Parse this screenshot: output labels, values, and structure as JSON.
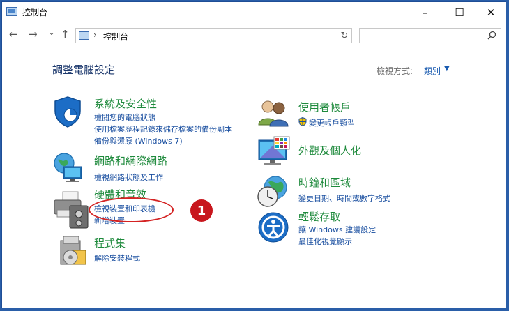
{
  "window": {
    "title": "控制台",
    "buttons": {
      "minimize": "–",
      "maximize": "☐",
      "close": "✕"
    }
  },
  "nav": {
    "back": "←",
    "forward": "→",
    "dropdown": "⌄",
    "up": "↑"
  },
  "address": {
    "separator": "›",
    "path": "控制台",
    "refresh": "↻"
  },
  "search": {
    "placeholder": "",
    "icon": "search-icon"
  },
  "heading": "調整電腦設定",
  "view": {
    "label": "檢視方式:",
    "value": "類別",
    "caret": "▼"
  },
  "categories_left": [
    {
      "title": "系統及安全性",
      "icon": "shield-icon",
      "links": [
        "檢閱您的電腦狀態",
        "使用檔案歷程記錄來儲存檔案的備份副本",
        "備份與還原 (Windows 7)"
      ]
    },
    {
      "title": "網路和網際網路",
      "icon": "network-globe-icon",
      "links": [
        "檢視網路狀態及工作"
      ]
    },
    {
      "title": "硬體和音效",
      "icon": "printer-icon",
      "links": [
        "檢視裝置和印表機",
        "新增裝置"
      ]
    },
    {
      "title": "程式集",
      "icon": "programs-icon",
      "links": [
        "解除安裝程式"
      ]
    }
  ],
  "categories_right": [
    {
      "title": "使用者帳戶",
      "icon": "users-icon",
      "links": [
        "變更帳戶類型"
      ]
    },
    {
      "title": "外觀及個人化",
      "icon": "monitor-icon",
      "links": []
    },
    {
      "title": "時鐘和區域",
      "icon": "clock-globe-icon",
      "links": [
        "變更日期、時間或數字格式"
      ]
    },
    {
      "title": "輕鬆存取",
      "icon": "ease-of-access-icon",
      "links": [
        "讓 Windows 建議設定",
        "最佳化視覺顯示"
      ]
    }
  ],
  "annotation": {
    "number": "1",
    "color": "#c8161d"
  },
  "colors": {
    "category_title": "#1e8a3c",
    "link": "#1a4fa0",
    "frame": "#2a5ea8"
  }
}
